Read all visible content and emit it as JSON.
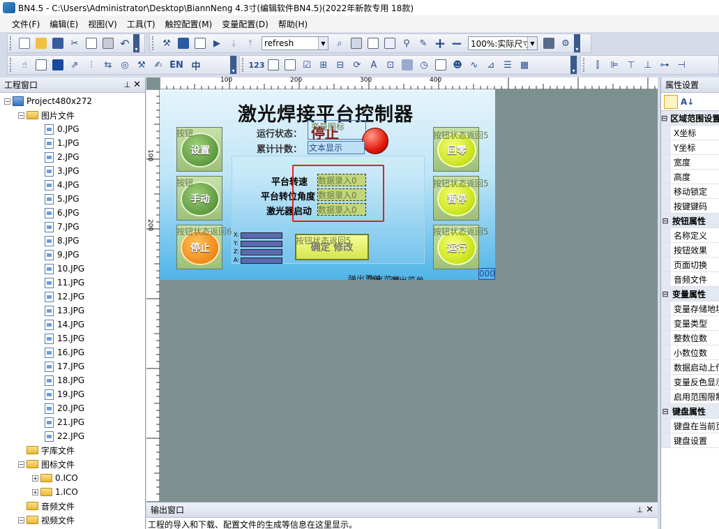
{
  "window": {
    "title": "BN4.5 - C:\\Users\\Administrator\\Desktop\\BiannNeng 4.3寸(编辑软件BN4.5)(2022年新款专用 18款)"
  },
  "menu": [
    "文件(F)",
    "编辑(E)",
    "视图(V)",
    "工具(T)",
    "触控配置(M)",
    "变量配置(D)",
    "帮助(H)"
  ],
  "toolbar": {
    "font_combo": "refresh",
    "zoom_combo": "100%:实际尺寸",
    "en_label": "EN",
    "zh_label": "中",
    "num_label": "123"
  },
  "project_panel": {
    "title": "工程窗口",
    "root": "Project480x272",
    "folders": {
      "images": "图片文件",
      "fonts": "字库文件",
      "icons": "图标文件",
      "audio": "音频文件",
      "video": "视频文件"
    },
    "image_files": [
      "0.JPG",
      "1.JPG",
      "2.JPG",
      "3.JPG",
      "4.JPG",
      "5.JPG",
      "6.JPG",
      "7.JPG",
      "8.JPG",
      "9.JPG",
      "10.JPG",
      "11.JPG",
      "12.JPG",
      "13.JPG",
      "14.JPG",
      "15.JPG",
      "16.JPG",
      "17.JPG",
      "18.JPG",
      "19.JPG",
      "20.JPG",
      "21.JPG",
      "22.JPG"
    ],
    "icon_files": [
      "0.ICO",
      "1.ICO"
    ]
  },
  "ruler": {
    "top": [
      "100",
      "200",
      "300",
      "400"
    ],
    "left": [
      "100",
      "200"
    ]
  },
  "canvas": {
    "title": "激光焊接平台控制器",
    "status_label": "运行状态：",
    "status_value": "停止",
    "var_icon_overlay": "变量图标",
    "count_label": "累计计数：",
    "count_box": "文本显示",
    "buttons": {
      "set": "设置",
      "manual": "手动",
      "stop": "停止",
      "reset": "回零",
      "pause": "暂停",
      "run": "运行"
    },
    "btn_overlays": {
      "set": "按钮",
      "manual": "按钮",
      "stop": "按钮状态返回6",
      "reset": "按钮状态返回5",
      "pause": "按钮状态返回5",
      "run": "按钮状态返回5"
    },
    "params": [
      "平台转速",
      "平台转位角度",
      "激光器启动"
    ],
    "data_input": "数据录入0",
    "axes": [
      "X:",
      "Y:",
      "Z:",
      "A:"
    ],
    "confirm_button": "确定 修改",
    "confirm_overlay": "按钮状态返回5",
    "popup_menu": "弹出菜单",
    "num_display": "000"
  },
  "output_panel": {
    "title": "输出窗口",
    "message": "工程的导入和下载、配置文件的生成等信息在这里显示。"
  },
  "props_panel": {
    "title": "属性设置",
    "sections": [
      {
        "name": "区域范围设置",
        "items": [
          "X坐标",
          "Y坐标",
          "宽度",
          "高度",
          "移动锁定",
          "按键键码"
        ]
      },
      {
        "name": "按钮属性",
        "items": [
          "名称定义",
          "按钮效果",
          "页面切换",
          "音频文件"
        ]
      },
      {
        "name": "变量属性",
        "items": [
          "变量存储地址",
          "变量类型",
          "整数位数",
          "小数位数",
          "数据启动上传",
          "变量反色显示",
          "启用范围限制"
        ]
      },
      {
        "name": "键盘属性",
        "items": [
          "键盘在当前页",
          "键盘设置"
        ]
      }
    ]
  }
}
